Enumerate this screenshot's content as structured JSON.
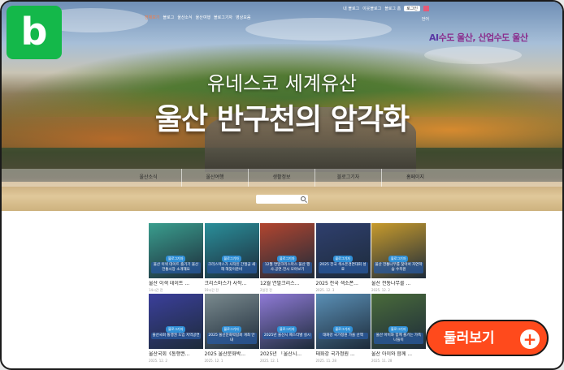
{
  "badge": {
    "letter": "b",
    "color": "#14b84a"
  },
  "utility_links": [
    "내 블로그",
    "이웃블로그",
    "블로그 홈",
    "로그인"
  ],
  "language": "언어",
  "top_menu": [
    "전체보기",
    "블로그",
    "울산소식",
    "울산여행",
    "블로그기자",
    "영상모음"
  ],
  "slogan": {
    "prefix": "AI",
    "text": "수도 울산, 산업수도 울산"
  },
  "hero": {
    "subtitle": "유네스코 세계유산",
    "title": "울산 반구천의 암각화"
  },
  "gnb": [
    "울산소식",
    "울산여행",
    "생활정보",
    "블로그기자",
    "홈페이지"
  ],
  "search": {
    "placeholder": ""
  },
  "cards": [
    {
      "title": "울산 이색 데이트 ...",
      "date": "14시간 전",
      "tag": "블로그기자",
      "caption": "울산 이색 데이트 즐기기 울산 전통시장 소개해요",
      "color": "#3a9e8e"
    },
    {
      "title": "크리스마스가 사작...",
      "date": "19시간 전",
      "tag": "블로그기자",
      "caption": "크리스마스가 사작된 간절곶 새해 해맞이준비",
      "color": "#2a8f9a"
    },
    {
      "title": "12월 연말크리스...",
      "date": "2일전 전",
      "tag": "블로그기자",
      "caption": "12월 연말크리스마스 울산 행사.공연.전시 모아보기",
      "color": "#b2452f"
    },
    {
      "title": "2025 전국 색소폰...",
      "date": "2025. 12. 3",
      "tag": "블로그기자",
      "caption": "2025 전국 색소폰경연대회 성료",
      "color": "#2f3f6e"
    },
    {
      "title": "울산 전통나무를 ...",
      "date": "2025. 12. 2",
      "tag": "블로그기자",
      "caption": "울산 전통나무를 찾아서 자연학습 수목원",
      "color": "#c89b2c"
    },
    {
      "title": "울산국회《통행권...",
      "date": "2025. 12. 2",
      "tag": "블로그기자",
      "caption": "울산국회 통행권 도입 지역공연",
      "color": "#3b3f9b"
    },
    {
      "title": "2025 울산문화박...",
      "date": "2025. 12. 1",
      "tag": "블로그기자",
      "caption": "2025 울산문화박람회 개최 안내",
      "color": "#7a8a8e"
    },
    {
      "title": "2025년 「울산시...",
      "date": "2025. 12. 1",
      "tag": "블로그기자",
      "caption": "2025년 울산시 페스티벌 실시",
      "color": "#8f7ad6"
    },
    {
      "title": "태화강 국가정원 ...",
      "date": "2025. 11. 28",
      "tag": "블로그기자",
      "caption": "태화강 국가정원 가을 산책",
      "color": "#5a8fb5"
    },
    {
      "title": "울산 아이와 함께 ...",
      "date": "2025. 11. 28",
      "tag": "블로그기자",
      "caption": "울산 아이와 함께 즐기는 가족 나들이",
      "color": "#4a6b3a"
    }
  ],
  "more_button": {
    "label": "둘러보기",
    "icon": "plus-icon",
    "color": "#ff4a1c"
  }
}
